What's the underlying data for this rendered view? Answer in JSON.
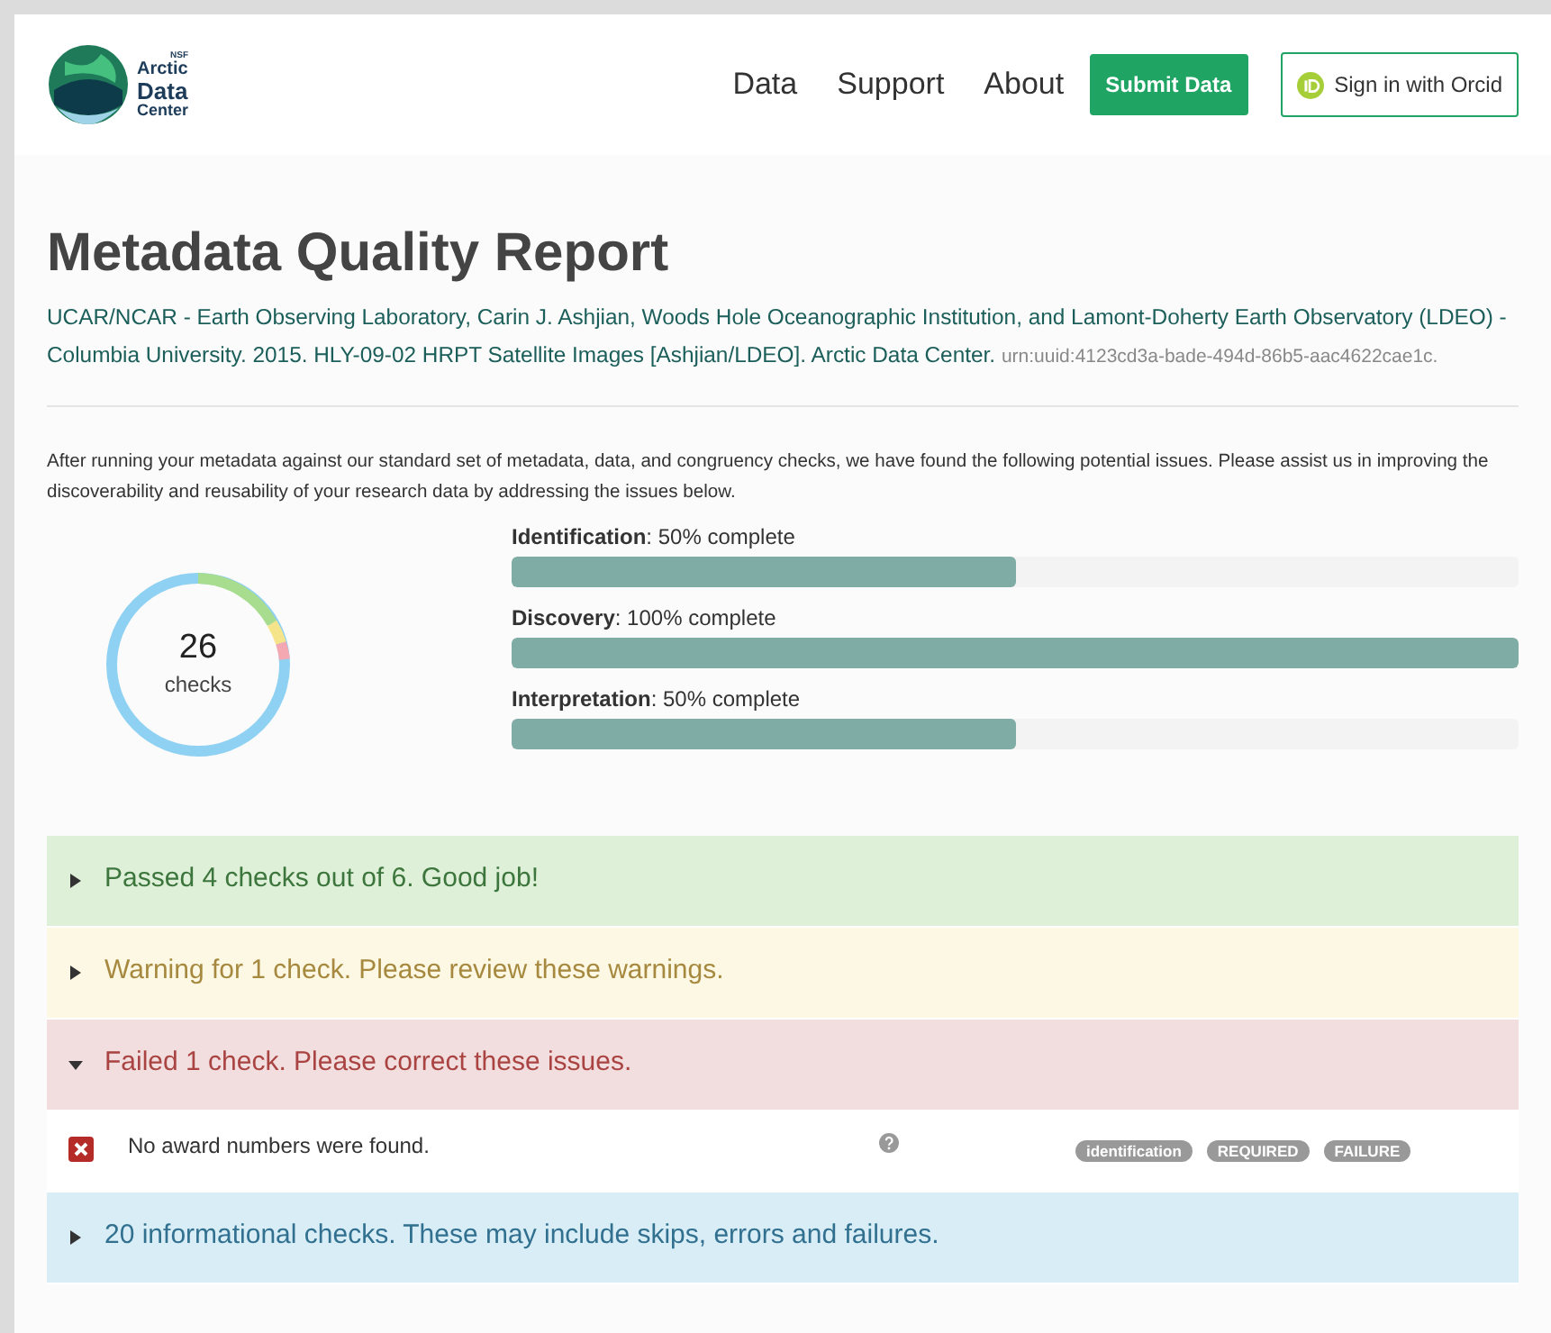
{
  "header": {
    "logo": {
      "small": "NSF",
      "line1": "Arctic",
      "line2": "Data",
      "line3": "Center"
    },
    "nav": [
      "Data",
      "Support",
      "About"
    ],
    "submit_button": "Submit Data",
    "signin_button": "Sign in with Orcid"
  },
  "title": "Metadata Quality Report",
  "citation": {
    "text": "UCAR/NCAR - Earth Observing Laboratory, Carin J. Ashjian, Woods Hole Oceanographic Institution, and Lamont-Doherty Earth Observatory (LDEO) - Columbia University. 2015. HLY-09-02 HRPT Satellite Images [Ashjian/LDEO]. Arctic Data Center.",
    "id": "urn:uuid:4123cd3a-bade-494d-86b5-aac4622cae1c."
  },
  "intro": "After running your metadata against our standard set of metadata, data, and congruency checks, we have found the following potential issues. Please assist us in improving the discoverability and reusability of your research data by addressing the issues below.",
  "summary": {
    "count": "26",
    "label": "checks"
  },
  "progress": [
    {
      "label": "**Identification**: 50% complete",
      "level": 0.5
    },
    {
      "label": "**Discovery**: 100% complete",
      "level": 1
    },
    {
      "label": "**Interpretation**: 50% complete",
      "level": 0.5
    }
  ],
  "sections": [
    {
      "kind": "passed",
      "text": "Passed 4 checks out of 6. Good job!",
      "expanded": false
    },
    {
      "kind": "warning",
      "text": "Warning for 1 check. Please review these warnings.",
      "expanded": false
    },
    {
      "kind": "failed",
      "text": "Failed 1 check. Please correct these issues.",
      "expanded": true,
      "items": [
        {
          "text": "No award numbers were found.",
          "tags": [
            "identification",
            "REQUIRED",
            "FAILURE"
          ]
        }
      ]
    },
    {
      "kind": "info",
      "text": "20 informational checks. These may include skips, errors and failures.",
      "expanded": false
    }
  ]
}
